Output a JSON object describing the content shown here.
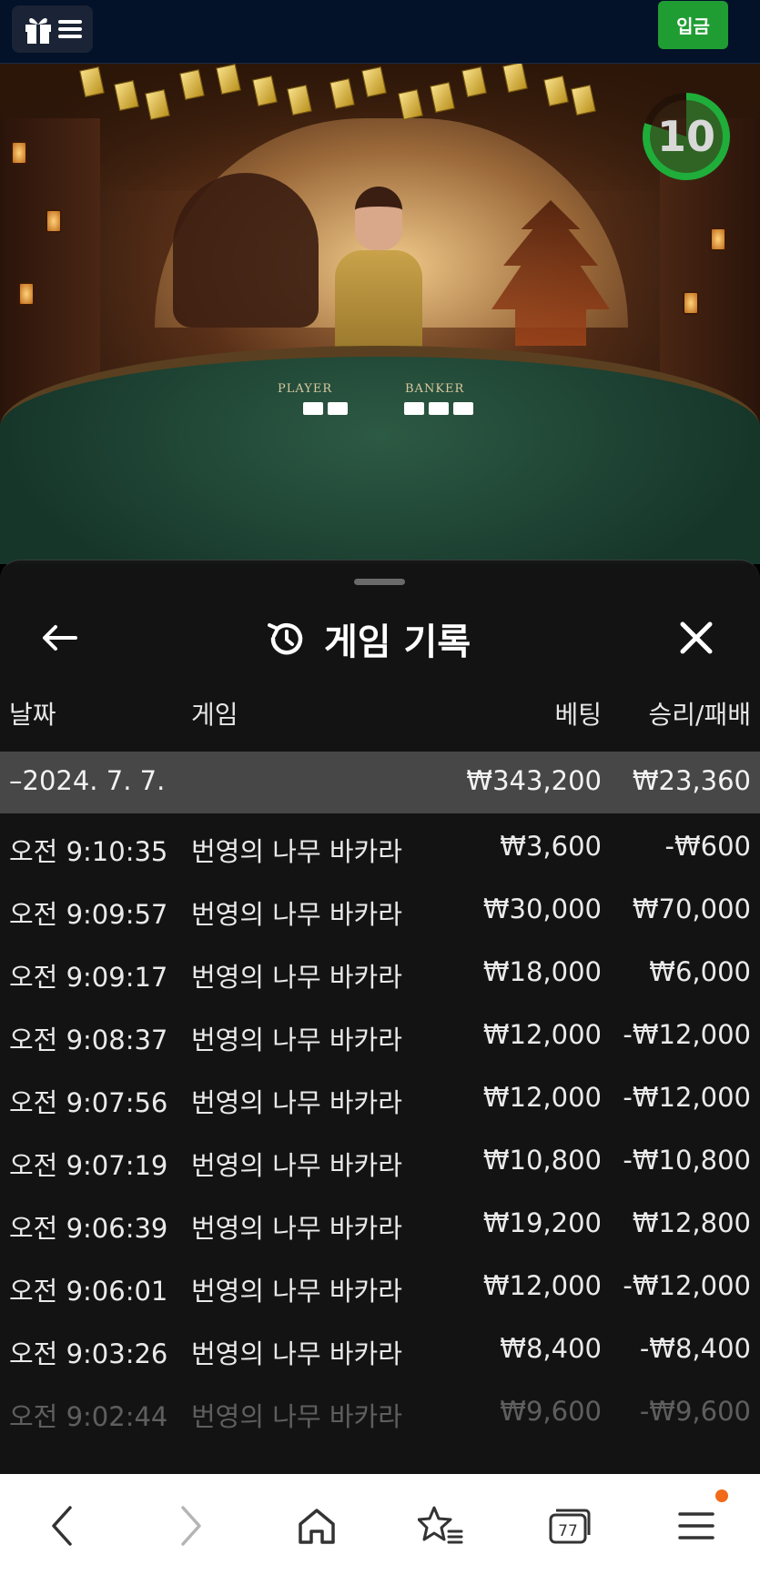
{
  "topbar": {
    "menu_icons": [
      "gift-icon",
      "hamburger-icon"
    ],
    "deposit_label": "입금",
    "deposit_color": "#1f9d32"
  },
  "game_view": {
    "timer_value": "10",
    "timer_progress": 0.8,
    "table_labels": [
      "PLAYER",
      "BANKER"
    ]
  },
  "history_sheet": {
    "title": "게임 기록",
    "title_icon": "history-icon",
    "back_icon": "arrow-left-icon",
    "close_icon": "close-icon",
    "columns": {
      "date": "날짜",
      "game": "게임",
      "bet": "베팅",
      "result": "승리/패배"
    },
    "date_group": {
      "label": "–2024. 7. 7.",
      "bet_total": "₩343,200",
      "result_total": "₩23,360"
    },
    "rows": [
      {
        "time": "오전 9:10:35",
        "game": "번영의 나무 바카라",
        "bet": "₩3,600",
        "result": "-₩600"
      },
      {
        "time": "오전 9:09:57",
        "game": "번영의 나무 바카라",
        "bet": "₩30,000",
        "result": "₩70,000"
      },
      {
        "time": "오전 9:09:17",
        "game": "번영의 나무 바카라",
        "bet": "₩18,000",
        "result": "₩6,000"
      },
      {
        "time": "오전 9:08:37",
        "game": "번영의 나무 바카라",
        "bet": "₩12,000",
        "result": "-₩12,000"
      },
      {
        "time": "오전 9:07:56",
        "game": "번영의 나무 바카라",
        "bet": "₩12,000",
        "result": "-₩12,000"
      },
      {
        "time": "오전 9:07:19",
        "game": "번영의 나무 바카라",
        "bet": "₩10,800",
        "result": "-₩10,800"
      },
      {
        "time": "오전 9:06:39",
        "game": "번영의 나무 바카라",
        "bet": "₩19,200",
        "result": "₩12,800"
      },
      {
        "time": "오전 9:06:01",
        "game": "번영의 나무 바카라",
        "bet": "₩12,000",
        "result": "-₩12,000"
      },
      {
        "time": "오전 9:03:26",
        "game": "번영의 나무 바카라",
        "bet": "₩8,400",
        "result": "-₩8,400"
      },
      {
        "time": "오전 9:02:44",
        "game": "번영의 나무 바카라",
        "bet": "₩9,600",
        "result": "-₩9,600"
      }
    ]
  },
  "bottom_nav": {
    "items": [
      "back-icon",
      "forward-icon",
      "home-icon",
      "bookmark-star-icon",
      "tabs-icon",
      "menu-icon"
    ],
    "tabs_count": "77",
    "notification_color": "#f06a1a"
  }
}
